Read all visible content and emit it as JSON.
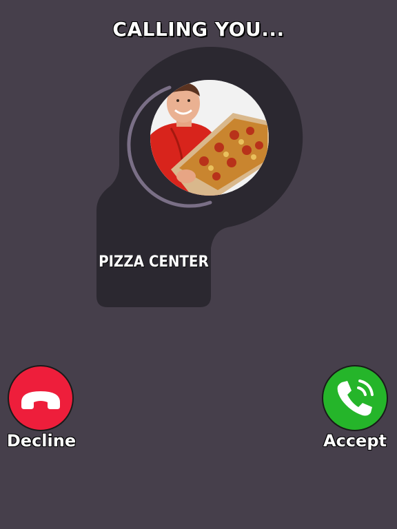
{
  "header": {
    "title": "CALLING YOU..."
  },
  "caller": {
    "name": "PIZZA CENTER",
    "avatar_description_icon": "pizza-delivery-man-photo"
  },
  "actions": {
    "decline_label": "Decline",
    "accept_label": "Accept",
    "decline_icon": "phone-hangup-icon",
    "accept_icon": "phone-ringing-icon"
  },
  "colors": {
    "background": "#463f4b",
    "card": "#2b2830",
    "ring": "#7a6f86",
    "decline": "#ee1e3b",
    "accept": "#25b52a"
  }
}
